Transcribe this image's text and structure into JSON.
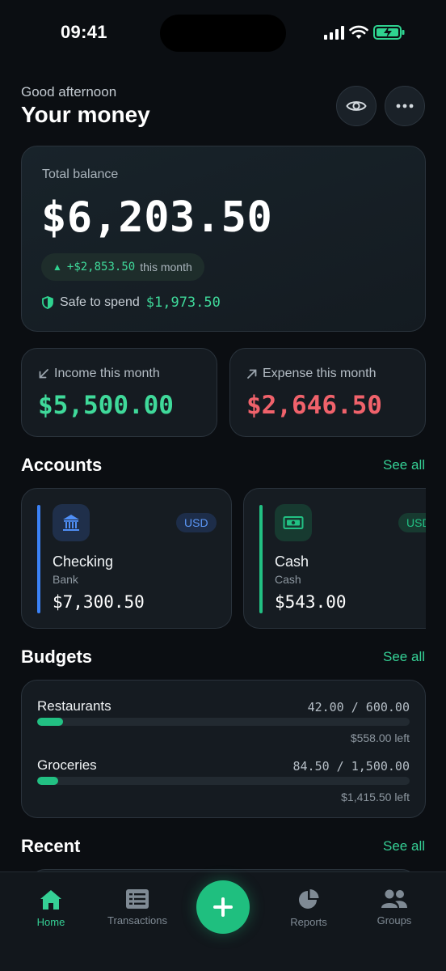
{
  "status_bar": {
    "time": "09:41"
  },
  "header": {
    "greeting": "Good afternoon",
    "title": "Your money"
  },
  "balance": {
    "label": "Total balance",
    "value": "$6,203.50",
    "change_amount": "+$2,853.50",
    "change_suffix": "this month",
    "safe_label": "Safe to spend",
    "safe_amount": "$1,973.50"
  },
  "income": {
    "label": "Income this month",
    "value": "$5,500.00"
  },
  "expense": {
    "label": "Expense this month",
    "value": "$2,646.50"
  },
  "accounts": {
    "title": "Accounts",
    "see_all": "See all",
    "items": [
      {
        "name": "Checking",
        "type": "Bank",
        "balance": "$7,300.50",
        "currency": "USD",
        "icon": "bank-icon",
        "accent": "#3b82f6"
      },
      {
        "name": "Cash",
        "type": "Cash",
        "balance": "$543.00",
        "currency": "USD",
        "icon": "cash-icon",
        "accent": "#22c083"
      }
    ]
  },
  "budgets": {
    "title": "Budgets",
    "see_all": "See all",
    "items": [
      {
        "name": "Restaurants",
        "amount": "42.00 / 600.00",
        "left": "$558.00 left",
        "progress": 0.07
      },
      {
        "name": "Groceries",
        "amount": "84.50 / 1,500.00",
        "left": "$1,415.50 left",
        "progress": 0.056
      }
    ]
  },
  "recent": {
    "title": "Recent",
    "see_all": "See all"
  },
  "nav": {
    "items": [
      {
        "label": "Home",
        "icon": "home-icon",
        "active": true
      },
      {
        "label": "Transactions",
        "icon": "transactions-icon",
        "active": false
      },
      {
        "label": "Reports",
        "icon": "reports-icon",
        "active": false
      },
      {
        "label": "Groups",
        "icon": "groups-icon",
        "active": false
      }
    ],
    "add_icon": "plus-icon"
  },
  "colors": {
    "accent": "#35d095",
    "income": "#3fd99a",
    "expense": "#f0626b",
    "background": "#0b0e12"
  }
}
